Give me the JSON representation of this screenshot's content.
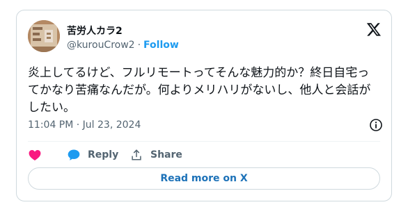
{
  "author": {
    "display_name": "苦労人カラ2",
    "handle": "@kurouCrow2",
    "separator": "·",
    "follow_label": "Follow",
    "avatar_icon": "user-avatar"
  },
  "brand": {
    "logo": "x-logo-icon"
  },
  "tweet": {
    "text": "炎上してるけど、フルリモートってそんな魅力的か？終日自宅ってかなり苦痛なんだが。何よりメリハリがないし、他人と会話がしたい。",
    "timestamp": "11:04 PM · Jul 23, 2024"
  },
  "actions": {
    "like_icon": "heart-icon",
    "reply_label": "Reply",
    "reply_icon": "speech-bubble-icon",
    "share_label": "Share",
    "share_icon": "share-upload-icon"
  },
  "footer": {
    "read_more_label": "Read more on X"
  },
  "colors": {
    "accent": "#1d9bf0",
    "like": "#f91880",
    "muted": "#536471",
    "border": "#cfd9de"
  }
}
